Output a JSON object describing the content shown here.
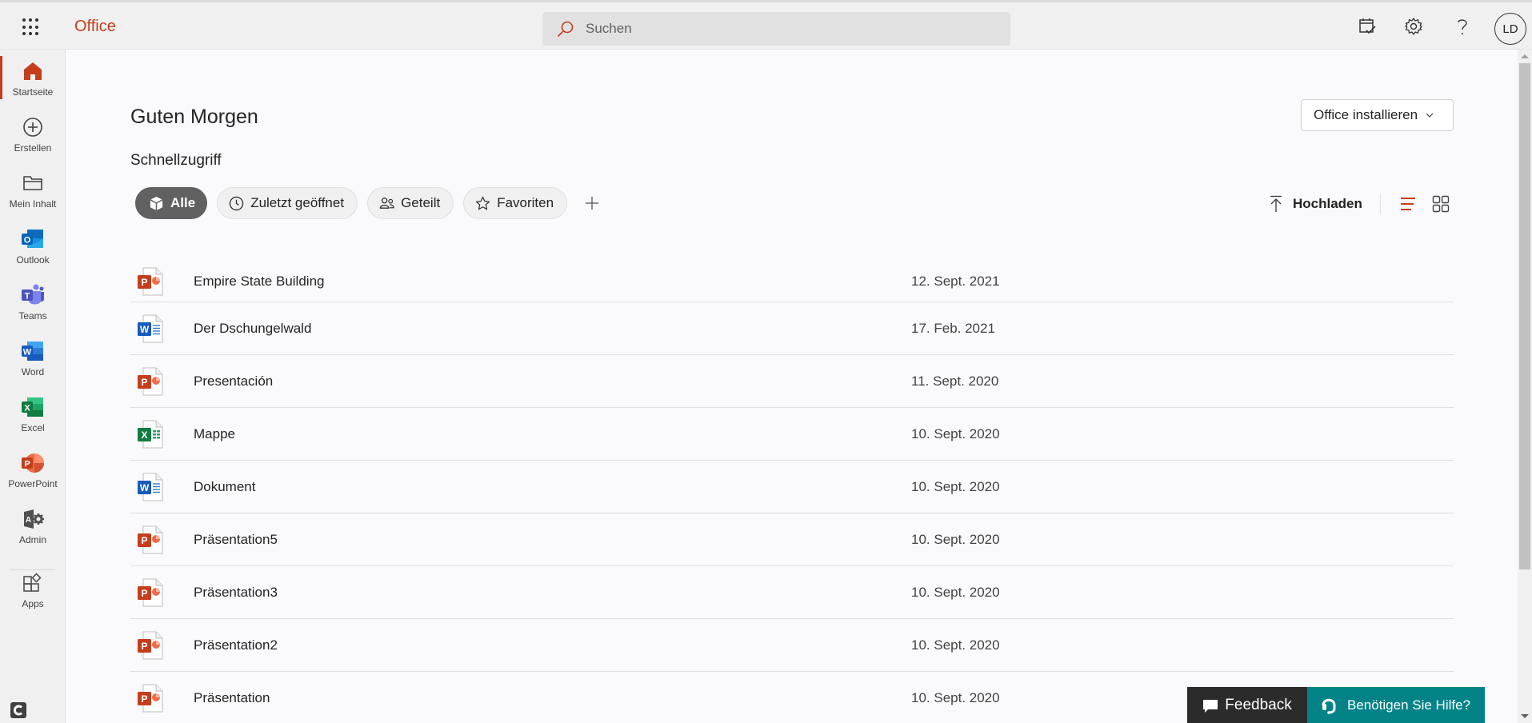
{
  "header": {
    "brand": "Office",
    "search_placeholder": "Suchen",
    "avatar_initials": "LD"
  },
  "colors": {
    "accent": "#c43e1c",
    "help_teal": "#038387",
    "feedback_dark": "#2b2b2b"
  },
  "sidebar": {
    "items": [
      {
        "label": "Startseite",
        "icon": "home-icon",
        "active": true
      },
      {
        "label": "Erstellen",
        "icon": "plus-circle-icon"
      },
      {
        "label": "Mein Inhalt",
        "icon": "folder-icon"
      },
      {
        "label": "Outlook",
        "icon": "outlook-icon"
      },
      {
        "label": "Teams",
        "icon": "teams-icon"
      },
      {
        "label": "Word",
        "icon": "word-icon"
      },
      {
        "label": "Excel",
        "icon": "excel-icon"
      },
      {
        "label": "PowerPoint",
        "icon": "powerpoint-icon"
      },
      {
        "label": "Admin",
        "icon": "admin-icon"
      },
      {
        "label": "Apps",
        "icon": "apps-icon"
      }
    ]
  },
  "main": {
    "greeting": "Guten Morgen",
    "section_title": "Schnellzugriff",
    "install_button": "Office installieren",
    "filters": [
      {
        "label": "Alle",
        "icon": "cube-icon",
        "active": true
      },
      {
        "label": "Zuletzt geöffnet",
        "icon": "clock-icon"
      },
      {
        "label": "Geteilt",
        "icon": "people-icon"
      },
      {
        "label": "Favoriten",
        "icon": "star-icon"
      }
    ],
    "upload_label": "Hochladen",
    "files": [
      {
        "name": "Empire State Building",
        "date": "12. Sept. 2021",
        "type": "powerpoint"
      },
      {
        "name": "Der Dschungelwald",
        "date": "17. Feb. 2021",
        "type": "word"
      },
      {
        "name": "Presentación",
        "date": "11. Sept. 2020",
        "type": "powerpoint"
      },
      {
        "name": "Mappe",
        "date": "10. Sept. 2020",
        "type": "excel"
      },
      {
        "name": "Dokument",
        "date": "10. Sept. 2020",
        "type": "word"
      },
      {
        "name": "Präsentation5",
        "date": "10. Sept. 2020",
        "type": "powerpoint"
      },
      {
        "name": "Präsentation3",
        "date": "10. Sept. 2020",
        "type": "powerpoint"
      },
      {
        "name": "Präsentation2",
        "date": "10. Sept. 2020",
        "type": "powerpoint"
      },
      {
        "name": "Präsentation",
        "date": "10. Sept. 2020",
        "type": "powerpoint"
      }
    ]
  },
  "footer": {
    "feedback_label": "Feedback",
    "help_label": "Benötigen Sie Hilfe?"
  }
}
